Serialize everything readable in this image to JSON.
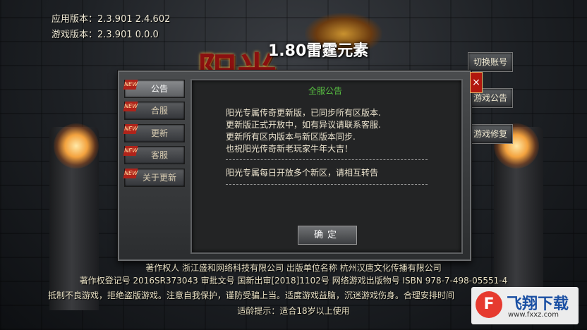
{
  "version": {
    "app": "应用版本：2.3.901  2.4.602",
    "game": "游戏版本：2.3.901  0.0.0"
  },
  "logo": {
    "title_big": "阳光",
    "badge": "1.80雷霆元素"
  },
  "side_buttons": {
    "switch_account": "切换账号",
    "game_notice": "游戏公告",
    "game_repair": "游戏修复"
  },
  "dialog": {
    "close": "×",
    "tabs": [
      {
        "label": "公告",
        "tag": "NEW",
        "active": true
      },
      {
        "label": "合服",
        "tag": "NEW",
        "active": false
      },
      {
        "label": "更新",
        "tag": "NEW",
        "active": false
      },
      {
        "label": "客服",
        "tag": "NEW",
        "active": false
      },
      {
        "label": "关于更新",
        "tag": "NEW",
        "active": false
      }
    ],
    "notice_title": "全服公告",
    "notice_lines": [
      "阳光专属传奇更新版，已同步所有区版本.",
      "更新版正式开放中，如有异议请联系客服.",
      "更新所有区内版本与新区版本同步.",
      "也祝阳光传奇新老玩家牛年大吉！"
    ],
    "notice_extra": "阳光专属每日开放多个新区，请相互转告",
    "confirm": "确定"
  },
  "footer": {
    "copyright": "著作权人 浙江盛和网络科技有限公司 出版单位名称 杭州汉唐文化传播有限公司",
    "registration": "著作权登记号 2016SR373043 审批文号 国新出审[2018]1102号 网络游戏出版物号 ISBN 978-7-498-05551-4",
    "health": "抵制不良游戏，拒绝盗版游戏。注意自我保护，谨防受骗上当。适度游戏益脑，沉迷游戏伤身。合理安排时间",
    "age": "适龄提示：适合18岁以上使用"
  },
  "watermark": {
    "name": "飞翔下载",
    "url": "www.fxxz.com"
  },
  "colors": {
    "notice_title": "#58c142",
    "close_red": "#b2180e",
    "tag_red": "#b0231a"
  }
}
